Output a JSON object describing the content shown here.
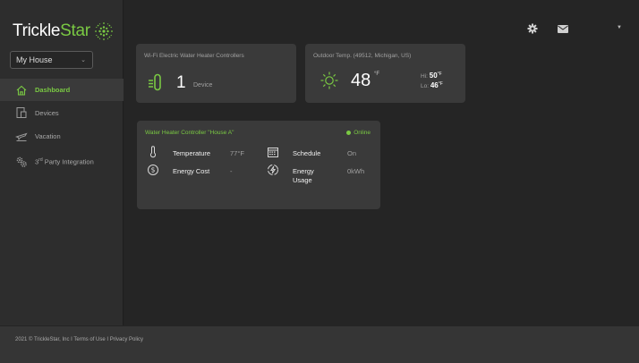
{
  "brand": {
    "logo_main": "Trickle",
    "logo_accent": "Star"
  },
  "house_select": {
    "value": "My House"
  },
  "nav": {
    "items": [
      {
        "label": "Dashboard",
        "active": true
      },
      {
        "label": "Devices",
        "active": false
      },
      {
        "label": "Vacation",
        "active": false
      },
      {
        "label_prefix": "3",
        "label_sup": "rd",
        "label_suffix": " Party Integration",
        "active": false
      }
    ]
  },
  "cards": {
    "controllers": {
      "title": "Wi-Fi Electric Water Heater Controllers",
      "count": "1",
      "unit": "Device"
    },
    "outdoor": {
      "title": "Outdoor Temp. (49512, Michigan, US)",
      "temp": "48",
      "temp_unit": "°F",
      "hi_label": "Hi:",
      "hi_value": "50",
      "lo_label": "Lo:",
      "lo_value": "46",
      "unit": "°F"
    },
    "heater": {
      "title": "Water Heater Controller \"House A\"",
      "status": "Online",
      "temperature_label": "Temperature",
      "temperature_value": "77°F",
      "schedule_label": "Schedule",
      "schedule_value": "On",
      "energy_cost_label": "Energy Cost",
      "energy_cost_value": "-",
      "energy_usage_label_1": "Energy",
      "energy_usage_label_2": "Usage",
      "energy_usage_value": "0kWh"
    }
  },
  "footer": {
    "copyright": "2021 © TrickleStar, Inc",
    "sep": " I ",
    "terms": "Terms of Use",
    "privacy": "Privacy Policy"
  },
  "colors": {
    "accent": "#7ac943",
    "background": "#252525",
    "card": "#3a3a3a"
  },
  "icons": [
    "gear-icon",
    "mail-icon",
    "caret-down-icon",
    "home-icon",
    "devices-icon",
    "plane-icon",
    "gears-icon",
    "heater-icon",
    "sun-icon",
    "thermometer-icon",
    "calendar-icon",
    "dollar-icon",
    "energy-icon"
  ]
}
